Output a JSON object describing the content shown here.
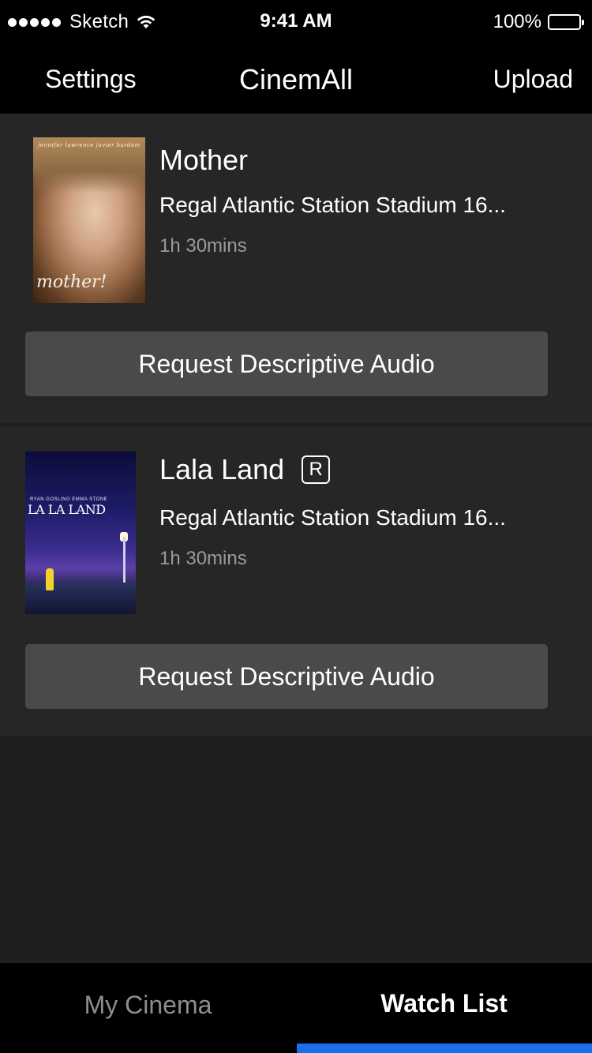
{
  "status_bar": {
    "carrier": "Sketch",
    "time": "9:41 AM",
    "battery_percent": "100%",
    "signal_bars": 5,
    "battery_level": 1.0
  },
  "nav": {
    "left_label": "Settings",
    "title": "CinemAll",
    "right_label": "Upload"
  },
  "movies": [
    {
      "title": "Mother",
      "rating": "",
      "theater": "Regal Atlantic Station Stadium 16...",
      "duration": "1h 30mins",
      "button_label": "Request Descriptive Audio",
      "poster_text": "mother!",
      "poster_credits": "jennifer lawrence   javier bardem"
    },
    {
      "title": "Lala Land",
      "rating": "R",
      "theater": "Regal Atlantic Station Stadium 16...",
      "duration": "1h 30mins",
      "button_label": "Request Descriptive Audio",
      "poster_text": "LA LA LAND",
      "poster_credits": "RYAN GOSLING   EMMA STONE"
    }
  ],
  "tabs": [
    {
      "label": "My Cinema",
      "active": false
    },
    {
      "label": "Watch List",
      "active": true
    }
  ],
  "colors": {
    "background": "#1f1f1f",
    "card": "#262626",
    "button": "#4a4a4a",
    "bars": "#000000",
    "tab_indicator": "#1a6eea",
    "inactive_tab_text": "#8e8e8e",
    "secondary_text": "#9a9a9a"
  }
}
